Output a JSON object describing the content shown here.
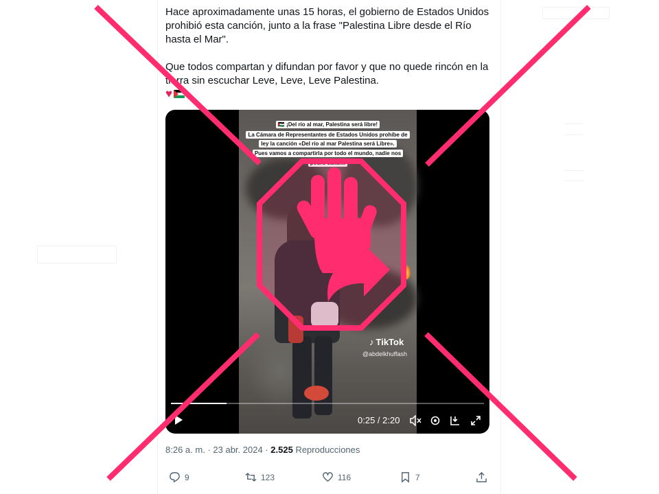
{
  "tweet": {
    "paragraph_1": "Hace aproximadamente unas 15 horas, el gobierno de Estados Unidos prohibió esta canción, junto a la frase \"Palestina Libre desde el Río hasta el Mar\".",
    "paragraph_2": "Que todos compartan y difundan por favor y que no quede rincón en la tierra sin escuchar Leve, Leve, Leve Palestina.",
    "emoji_icons": [
      "heart-icon",
      "palestine-flag-icon"
    ]
  },
  "video": {
    "caption_lines": [
      "🇵🇸 ¡Del río al mar, Palestina será libre!",
      "La Cámara de Representantes de Estados Unidos prohíbe de",
      "ley la canción «Del río al mar Palestina será Libre».",
      "Pues vamos a compartirla por todo el mundo, nadie nos",
      "podrá callar..."
    ],
    "watermark_brand": "TikTok",
    "watermark_handle": "@abdelkhuffash",
    "time_readout": "0:25 / 2:20",
    "progress_fraction": 0.178,
    "controls": [
      "play-icon",
      "mute-icon",
      "settings-icon",
      "dock-icon",
      "fullscreen-icon"
    ]
  },
  "meta": {
    "time": "8:26 a. m.",
    "date": "23 abr. 2024",
    "views_count": "2.525",
    "views_label": "Reproducciones"
  },
  "actions": {
    "replies": "9",
    "reposts": "123",
    "likes": "116",
    "bookmarks": "7"
  },
  "colors": {
    "overlay_accent": "#ff2d6f",
    "text_primary": "#0f1419",
    "text_secondary": "#536471"
  }
}
